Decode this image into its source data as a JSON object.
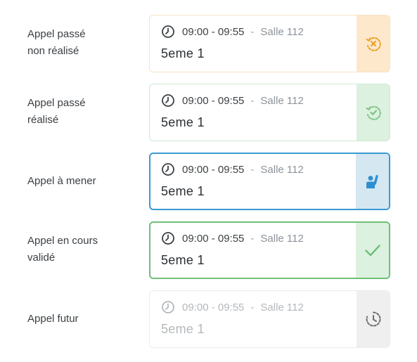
{
  "rows": [
    {
      "label_line1": "Appel passé",
      "label_line2": "non réalisé",
      "time": "09:00 - 09:55",
      "separator": "-",
      "room": "Salle 112",
      "course": "5eme 1",
      "status_icon": "history-cross-icon",
      "accent": "#f0a021"
    },
    {
      "label_line1": "Appel passé",
      "label_line2": "réalisé",
      "time": "09:00 - 09:55",
      "separator": "-",
      "room": "Salle 112",
      "course": "5eme 1",
      "status_icon": "history-check-icon",
      "accent": "#7cc485"
    },
    {
      "label_line1": "Appel à mener",
      "time": "09:00 - 09:55",
      "separator": "-",
      "room": "Salle 112",
      "course": "5eme 1",
      "status_icon": "raised-hand-person-icon",
      "accent": "#2e8fd0"
    },
    {
      "label_line1": "Appel en cours",
      "label_line2": "validé",
      "time": "09:00 - 09:55",
      "separator": "-",
      "room": "Salle 112",
      "course": "5eme 1",
      "status_icon": "checkmark-icon",
      "accent": "#6fbf77"
    },
    {
      "label_line1": "Appel futur",
      "time": "09:00 - 09:55",
      "separator": "-",
      "room": "Salle 112",
      "course": "5eme 1",
      "status_icon": "clock-dashed-icon",
      "accent": "#6b6f73"
    }
  ]
}
